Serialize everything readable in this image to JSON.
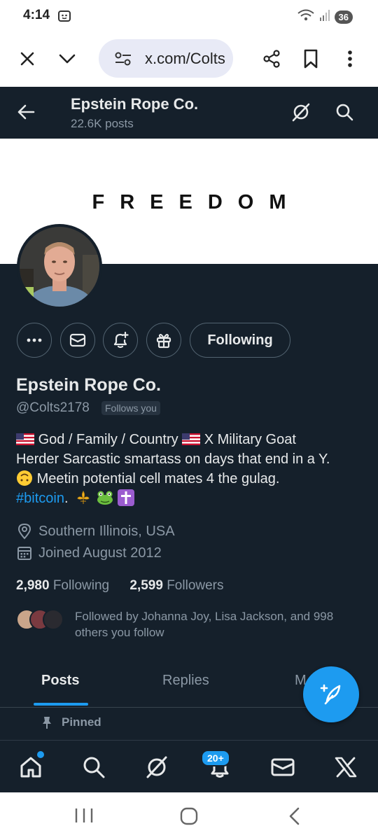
{
  "status_bar": {
    "time": "4:14",
    "battery": "36"
  },
  "browser": {
    "url": "x.com/Colts"
  },
  "header": {
    "title": "Epstein Rope Co.",
    "posts_count": "22.6K posts"
  },
  "banner": {
    "text": "FREEDOM"
  },
  "actions": {
    "follow_label": "Following"
  },
  "profile": {
    "name": "Epstein Rope Co.",
    "handle": "@Colts2178",
    "follows_you": "Follows you",
    "bio_line1_a": "God / Family / Country",
    "bio_line1_b": "X Military Goat",
    "bio_line2": "Herder Sarcastic smartass on days that end in a Y.",
    "bio_line3": "Meetin potential cell mates 4 the gulag.",
    "bio_hashtag": "#bitcoin",
    "location": "Southern Illinois, USA",
    "joined": "Joined August 2012",
    "following_count": "2,980",
    "following_label": "Following",
    "followers_count": "2,599",
    "followers_label": "Followers",
    "followed_by": "Followed by Johanna Joy, Lisa Jackson, and 998 others you follow"
  },
  "tabs": [
    {
      "label": "Posts"
    },
    {
      "label": "Replies"
    },
    {
      "label": "M"
    }
  ],
  "pinned": {
    "label": "Pinned"
  },
  "bottom_nav": {
    "notif_badge": "20+"
  },
  "colors": {
    "background": "#15202b",
    "accent": "#1d9bf0",
    "secondary_text": "#8b98a5"
  }
}
